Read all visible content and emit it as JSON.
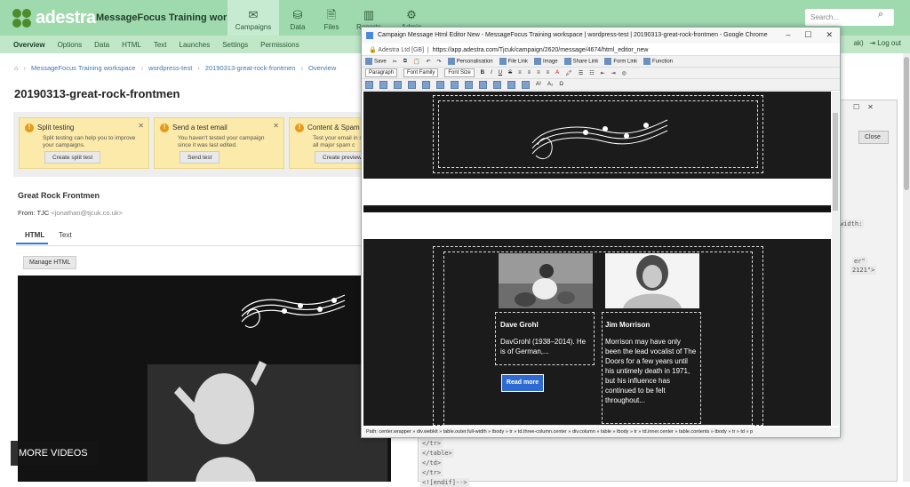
{
  "app": {
    "brand": "adestra",
    "workspace_title": "MessageFocus Training work...",
    "nav": [
      {
        "label": "Campaigns",
        "icon": "envelope-icon",
        "active": true
      },
      {
        "label": "Data",
        "icon": "database-icon"
      },
      {
        "label": "Files",
        "icon": "file-icon"
      },
      {
        "label": "Reports",
        "icon": "bar-chart-icon"
      },
      {
        "label": "Admin",
        "icon": "gear-icon"
      }
    ],
    "search_placeholder": "Search..."
  },
  "subnav": {
    "items": [
      "Overview",
      "Options",
      "Data",
      "HTML",
      "Text",
      "Launches",
      "Settings",
      "Permissions"
    ],
    "right_partial": "ak)",
    "logout": "Log out"
  },
  "breadcrumb": [
    "MessageFocus Training workspace",
    "wordpress-test",
    "20190313-great-rock-frontmen",
    "Overview"
  ],
  "page_title": "20190313-great-rock-frontmen",
  "cards": [
    {
      "title": "Split testing",
      "body": "Split testing can help you to improve your campaigns.",
      "button": "Create split test"
    },
    {
      "title": "Send a test email",
      "body": "You haven't tested your campaign since it was last edited.",
      "button": "Send test"
    },
    {
      "title": "Content & Spam C",
      "body": "Test your email in sev and all major spam c",
      "button": "Create preview"
    }
  ],
  "campaign": {
    "name": "Great Rock Frontmen",
    "from_label": "From: TJC",
    "from_email": "<jonathan@tjcuk.co.uk>",
    "tabs": [
      "HTML",
      "Text"
    ],
    "manage_button": "Manage HTML"
  },
  "video_overlay": "MORE VIDEOS",
  "bg_panel": {
    "close_button": "Close",
    "code_lines": [
      "width:",
      "er\"",
      "2121\">",
      "</tr>",
      "</table>",
      "</td>",
      "</tr>",
      "<![endif]-->"
    ]
  },
  "popup": {
    "title": "Campaign Message Html Editor New - MessageFocus Training workspace | wordpress-test | 20190313-great-rock-frontmen - Google Chrome",
    "url_owner": "Adestra Ltd [GB]",
    "url": "https://app.adestra.com/Tjcuk/campaign/2620/message/4674/html_editor_new",
    "toolbar1": [
      "Save",
      "Personalisation",
      "File Link",
      "Image",
      "Share Link",
      "Form Link",
      "Function"
    ],
    "toolbar2": {
      "format": "Paragraph",
      "font_family": "Font Family",
      "font_size": "Font Size",
      "buttons": [
        "B",
        "I",
        "U",
        "S"
      ]
    },
    "path": "Path: center.wrapper » div.webkit » table.outer.full-width » tbody » tr » td.three-column.center » div.column » table » tbody » tr » td.inner.center » table.contents » tbody » tr » td » p"
  },
  "people": [
    {
      "name": "Dave Grohl",
      "bio": "DavGrohl (1938–2014). He is of German,..."
    },
    {
      "name": "Jim Morrison",
      "bio": "Morrison may have only been the lead vocalist of The Doors for a few years until his untimely death in 1971, but his influence has continued to be felt throughout..."
    }
  ],
  "read_more": "Read more",
  "colors": {
    "topbar": "#9fd9ae",
    "brand_green": "#4d8c2c",
    "read_more": "#2d6ad1"
  }
}
